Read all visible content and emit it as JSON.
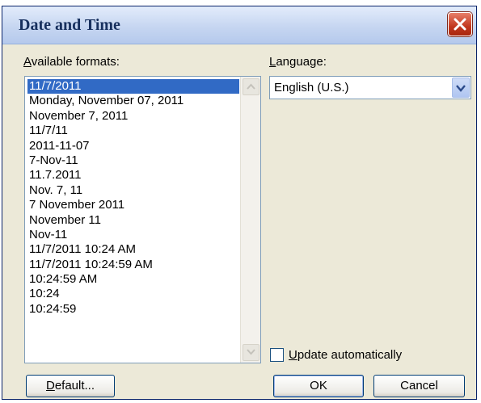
{
  "dialog": {
    "title": "Date and Time"
  },
  "formats": {
    "label": "Available formats:",
    "label_accel": "A",
    "label_rest": "vailable formats:",
    "items": [
      "11/7/2011",
      "Monday, November 07, 2011",
      "November 7, 2011",
      "11/7/11",
      "2011-11-07",
      "7-Nov-11",
      "11.7.2011",
      "Nov. 7, 11",
      "7 November 2011",
      "November 11",
      "Nov-11",
      "11/7/2011 10:24 AM",
      "11/7/2011 10:24:59 AM",
      "10:24:59 AM",
      "10:24",
      "10:24:59"
    ],
    "selected_index": 0
  },
  "language": {
    "label_accel": "L",
    "label_rest": "anguage:",
    "value": "English (U.S.)"
  },
  "update": {
    "label_accel": "U",
    "label_rest": "pdate automatically",
    "checked": false
  },
  "buttons": {
    "default_accel": "D",
    "default_rest": "efault...",
    "ok": "OK",
    "cancel": "Cancel"
  },
  "background_fragments": [
    "r",
    "r"
  ],
  "colors": {
    "selection": "#316ac5",
    "title_text": "#17305e",
    "close_button": "#c2381f"
  }
}
